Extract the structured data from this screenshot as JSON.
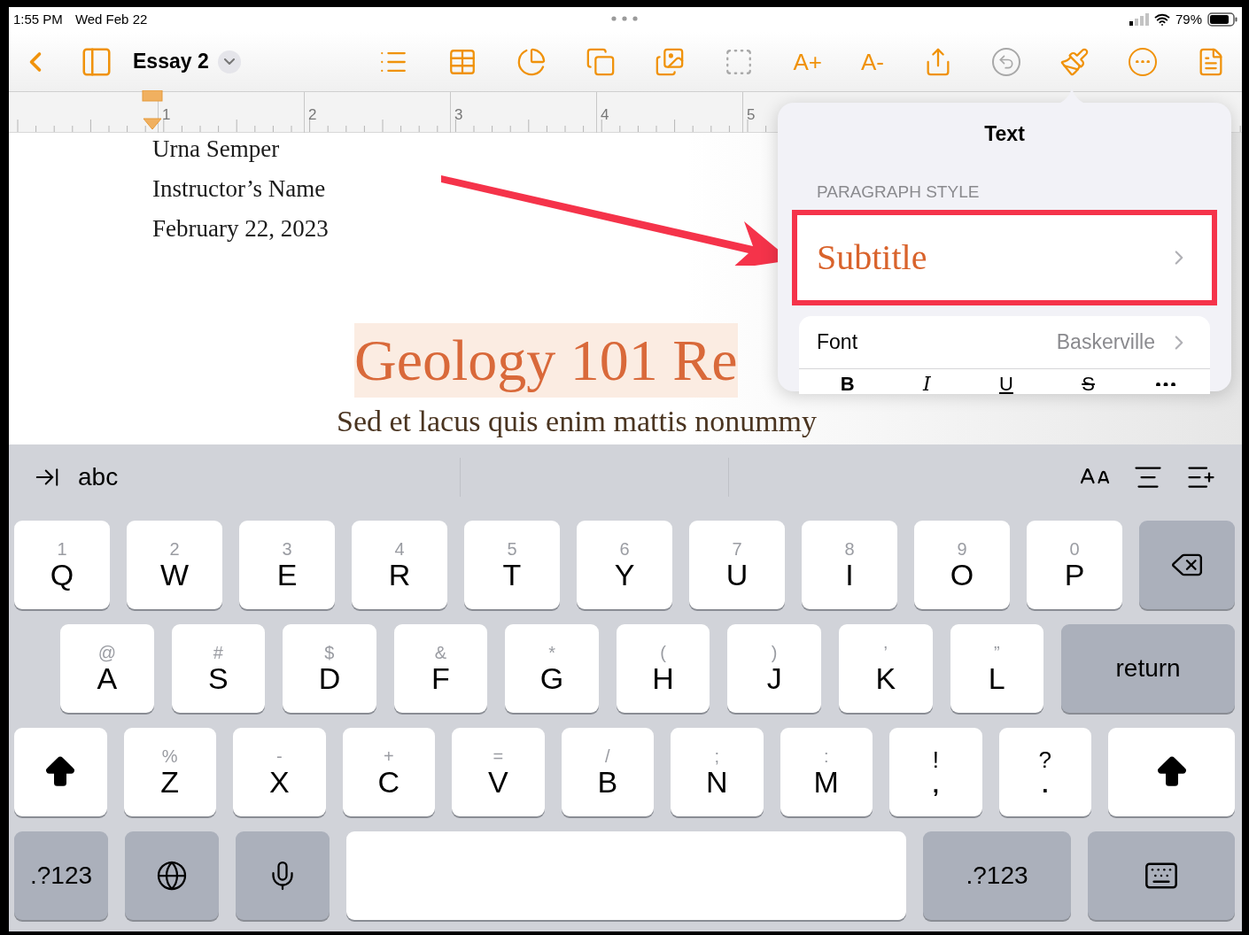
{
  "status_bar": {
    "time": "1:55 PM",
    "date": "Wed Feb 22",
    "battery": "79%"
  },
  "toolbar": {
    "title": "Essay 2",
    "tools": [
      {
        "kind": "list",
        "disabled": false
      },
      {
        "kind": "table",
        "disabled": false
      },
      {
        "kind": "chart",
        "disabled": false
      },
      {
        "kind": "shapes",
        "disabled": false
      },
      {
        "kind": "media",
        "disabled": false
      },
      {
        "kind": "copy-style",
        "disabled": true
      },
      {
        "kind": "text",
        "label": "A+",
        "disabled": false
      },
      {
        "kind": "text",
        "label": "A-",
        "disabled": false
      },
      {
        "kind": "share",
        "disabled": false
      },
      {
        "kind": "undo",
        "disabled": true
      },
      {
        "kind": "format",
        "disabled": false
      },
      {
        "kind": "more",
        "disabled": false
      },
      {
        "kind": "reader",
        "disabled": false
      }
    ]
  },
  "ruler": {
    "numbers": [
      "1",
      "2",
      "3",
      "4",
      "5"
    ]
  },
  "document": {
    "header_lines": [
      "Urna Semper",
      "Instructor’s Name",
      "February 22, 2023"
    ],
    "title": "Geology 101 Re",
    "subtitle": "Sed et lacus quis enim mattis nonummy"
  },
  "popover": {
    "title": "Text",
    "section": "PARAGRAPH STYLE",
    "paragraph_style": "Subtitle",
    "font_label": "Font",
    "font_value": "Baskerville",
    "format_buttons": [
      {
        "kind": "bold",
        "label": "B"
      },
      {
        "kind": "italic",
        "label": "I"
      },
      {
        "kind": "underline",
        "label": "U"
      },
      {
        "kind": "strike",
        "label": "S"
      },
      {
        "kind": "more"
      }
    ]
  },
  "keyboard": {
    "shortcut_label": "abc",
    "rows": [
      {
        "keys": [
          {
            "kind": "letter",
            "hint": "1",
            "label": "Q"
          },
          {
            "kind": "letter",
            "hint": "2",
            "label": "W"
          },
          {
            "kind": "letter",
            "hint": "3",
            "label": "E"
          },
          {
            "kind": "letter",
            "hint": "4",
            "label": "R"
          },
          {
            "kind": "letter",
            "hint": "5",
            "label": "T"
          },
          {
            "kind": "letter",
            "hint": "6",
            "label": "Y"
          },
          {
            "kind": "letter",
            "hint": "7",
            "label": "U"
          },
          {
            "kind": "letter",
            "hint": "8",
            "label": "I"
          },
          {
            "kind": "letter",
            "hint": "9",
            "label": "O"
          },
          {
            "kind": "letter",
            "hint": "0",
            "label": "P"
          },
          {
            "kind": "backspace"
          }
        ]
      },
      {
        "keys": [
          {
            "kind": "letter",
            "hint": "@",
            "label": "A"
          },
          {
            "kind": "letter",
            "hint": "#",
            "label": "S"
          },
          {
            "kind": "letter",
            "hint": "$",
            "label": "D"
          },
          {
            "kind": "letter",
            "hint": "&",
            "label": "F"
          },
          {
            "kind": "letter",
            "hint": "*",
            "label": "G"
          },
          {
            "kind": "letter",
            "hint": "(",
            "label": "H"
          },
          {
            "kind": "letter",
            "hint": ")",
            "label": "J"
          },
          {
            "kind": "letter",
            "hint": "’",
            "label": "K"
          },
          {
            "kind": "letter",
            "hint": "”",
            "label": "L"
          },
          {
            "kind": "return",
            "label": "return"
          }
        ]
      },
      {
        "keys": [
          {
            "kind": "shift"
          },
          {
            "kind": "letter",
            "hint": "%",
            "label": "Z"
          },
          {
            "kind": "letter",
            "hint": "-",
            "label": "X"
          },
          {
            "kind": "letter",
            "hint": "+",
            "label": "C"
          },
          {
            "kind": "letter",
            "hint": "=",
            "label": "V"
          },
          {
            "kind": "letter",
            "hint": "/",
            "label": "B"
          },
          {
            "kind": "letter",
            "hint": ";",
            "label": "N"
          },
          {
            "kind": "letter",
            "hint": ":",
            "label": "M"
          },
          {
            "kind": "punct",
            "hint": "!",
            "label": ","
          },
          {
            "kind": "punct",
            "hint": "?",
            "label": "."
          },
          {
            "kind": "shift"
          }
        ]
      },
      {
        "keys": [
          {
            "kind": "mode",
            "label": ".?123"
          },
          {
            "kind": "globe"
          },
          {
            "kind": "mic"
          },
          {
            "kind": "space"
          },
          {
            "kind": "mode",
            "label": ".?123"
          },
          {
            "kind": "hide"
          }
        ]
      }
    ]
  }
}
